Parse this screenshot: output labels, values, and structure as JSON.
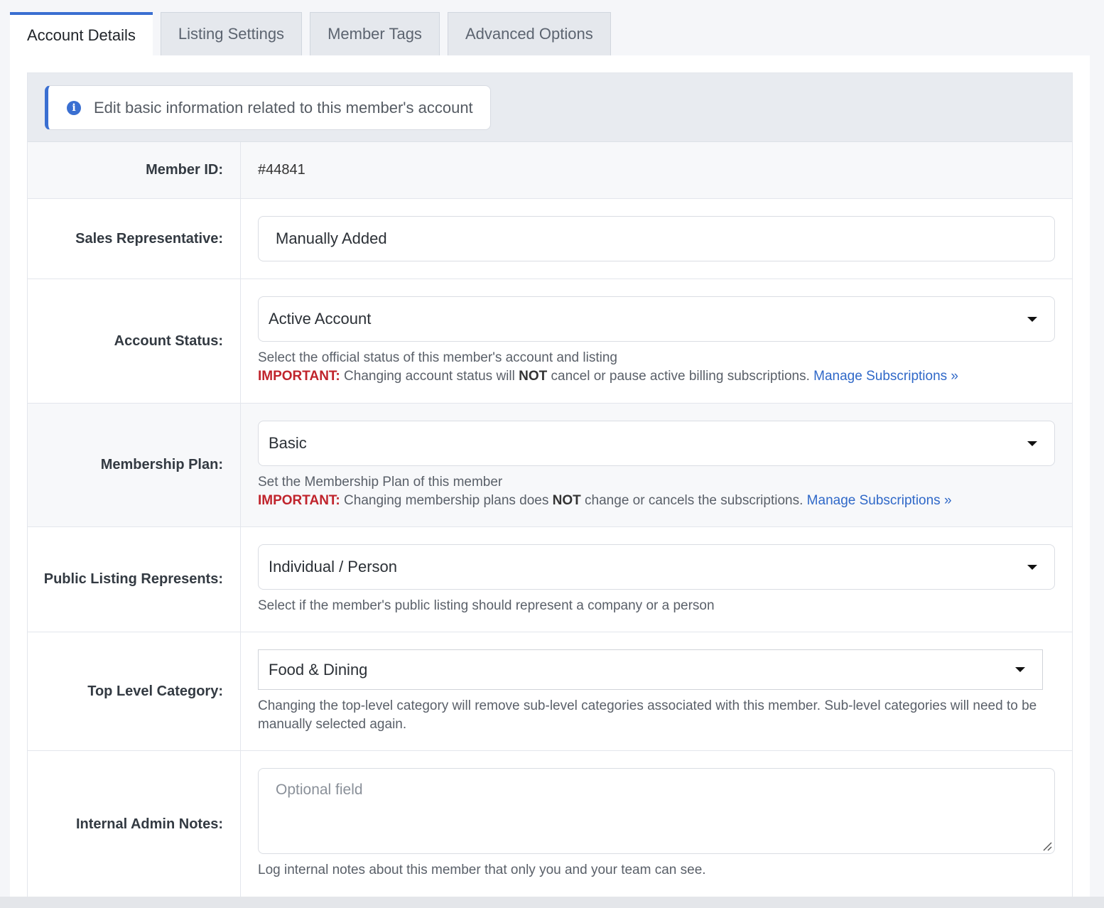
{
  "tabs": [
    {
      "label": "Account Details",
      "active": true
    },
    {
      "label": "Listing Settings",
      "active": false
    },
    {
      "label": "Member Tags",
      "active": false
    },
    {
      "label": "Advanced Options",
      "active": false
    }
  ],
  "info": {
    "icon": "info-circle-icon",
    "text": "Edit basic information related to this member's account"
  },
  "member_id": {
    "label": "Member ID:",
    "value": "#44841"
  },
  "sales_rep": {
    "label": "Sales Representative:",
    "value": "Manually Added"
  },
  "account_status": {
    "label": "Account Status:",
    "value": "Active Account",
    "help": "Select the official status of this member's account and listing",
    "important_label": "IMPORTANT:",
    "important_pre": "Changing account status will",
    "important_bold": "NOT",
    "important_post": "cancel or pause active billing subscriptions.",
    "link": "Manage Subscriptions »"
  },
  "membership_plan": {
    "label": "Membership Plan:",
    "value": "Basic",
    "help": "Set the Membership Plan of this member",
    "important_label": "IMPORTANT:",
    "important_pre": "Changing membership plans does",
    "important_bold": "NOT",
    "important_post": "change or cancels the subscriptions.",
    "link": "Manage Subscriptions »"
  },
  "listing_represents": {
    "label": "Public Listing Represents:",
    "value": "Individual / Person",
    "help": "Select if the member's public listing should represent a company or a person"
  },
  "top_category": {
    "label": "Top Level Category:",
    "value": "Food & Dining",
    "help": "Changing the top-level category will remove sub-level categories associated with this member. Sub-level categories will need to be manually selected again."
  },
  "admin_notes": {
    "label": "Internal Admin Notes:",
    "placeholder": "Optional field",
    "help": "Log internal notes about this member that only you and your team can see."
  },
  "colors": {
    "accent": "#3a6fd1",
    "important": "#c0242c",
    "link": "#2f68c8"
  }
}
